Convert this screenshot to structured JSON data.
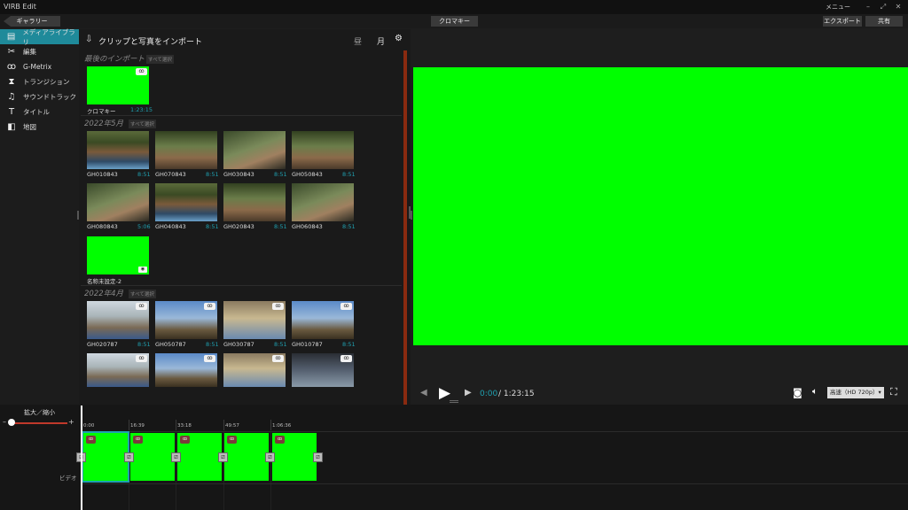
{
  "app": {
    "title": "VIRB Edit",
    "menu_label": "メニュー"
  },
  "window_controls": {
    "minimize_icon": "minimize-icon",
    "restore_icon": "restore-icon",
    "close_icon": "close-icon"
  },
  "toolbar": {
    "gallery_label": "ギャラリー",
    "project_label": "クロマキー",
    "export_label": "エクスポート",
    "share_label": "共有"
  },
  "nav": {
    "items": [
      {
        "label": "メディアライブラリ",
        "icon": "▤"
      },
      {
        "label": "編集",
        "icon": "✂"
      },
      {
        "label": "G-Metrix",
        "icon": "ꝏ"
      },
      {
        "label": "トランジション",
        "icon": "⧗"
      },
      {
        "label": "サウンドトラック",
        "icon": "♫"
      },
      {
        "label": "タイトル",
        "icon": "T"
      },
      {
        "label": "地図",
        "icon": "◧"
      }
    ]
  },
  "library": {
    "import_label": "クリップと写真をインポート",
    "day_label": "昼",
    "month_label": "月",
    "select_all_label": "すべて選択",
    "sections": [
      {
        "title": "最後のインポート"
      },
      {
        "title": "2022年5月"
      },
      {
        "title": "2022年4月"
      }
    ],
    "clips": [
      {
        "name": "クロマキー",
        "duration": "1:23:15"
      },
      {
        "name": "GH010843",
        "duration": "8:51"
      },
      {
        "name": "GH070843",
        "duration": "8:51"
      },
      {
        "name": "GH030843",
        "duration": "8:51"
      },
      {
        "name": "GH050843",
        "duration": "8:51"
      },
      {
        "name": "GH080843",
        "duration": "5:06"
      },
      {
        "name": "GH040843",
        "duration": "8:51"
      },
      {
        "name": "GH020843",
        "duration": "8:51"
      },
      {
        "name": "GH060843",
        "duration": "8:51"
      },
      {
        "name": "名称未設定-2",
        "duration": ""
      },
      {
        "name": "GH020787",
        "duration": "8:51"
      },
      {
        "name": "GH050787",
        "duration": "8:51"
      },
      {
        "name": "GH030787",
        "duration": "8:51"
      },
      {
        "name": "GH010787",
        "duration": "8:51"
      }
    ]
  },
  "preview": {
    "time_current": "0:00",
    "time_total": "/ 1:23:15",
    "quality_label": "高速（HD 720p）▾",
    "screen_color": "#00ff00"
  },
  "timeline": {
    "zoom_label": "拡大／縮小",
    "zoom_minus": "–",
    "zoom_plus": "+",
    "zoom_level": 0.05,
    "ticks": [
      "0:00",
      "16:39",
      "33:18",
      "49:57",
      "1:06:36"
    ],
    "track_label": "ビデオ",
    "clip_count": 5
  },
  "colors": {
    "accent": "#1fa0b0",
    "chroma": "#00ff00",
    "scrollbar": "#8a2a10"
  }
}
